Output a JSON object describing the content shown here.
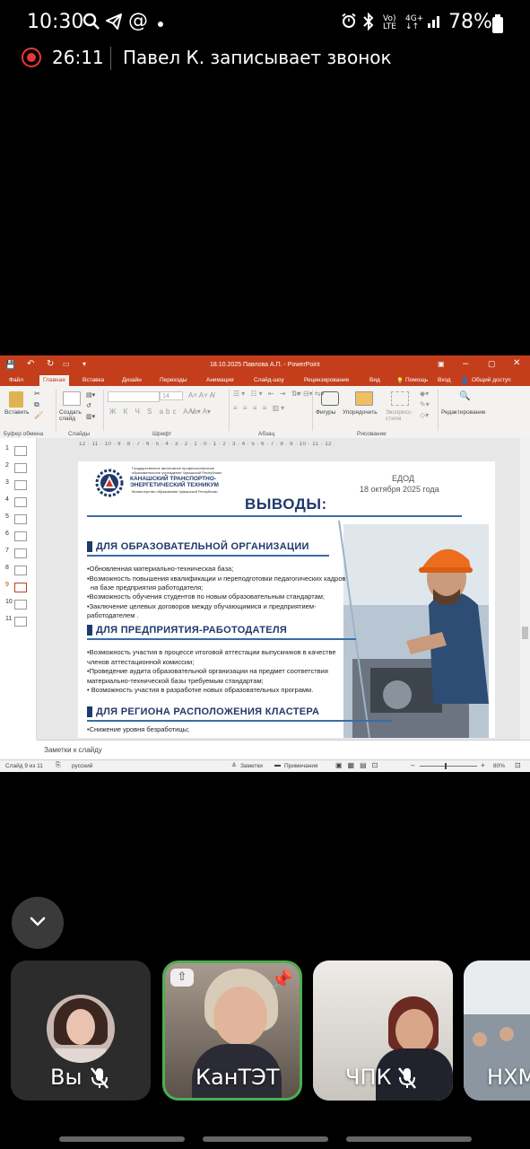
{
  "status_bar": {
    "time": "10:30",
    "battery": "78%",
    "icons": [
      "search-icon",
      "telegram-icon",
      "at-icon",
      "dot-icon",
      "alarm-icon",
      "bluetooth-icon",
      "volte-icon",
      "4g-icon",
      "signal-icon",
      "battery-icon"
    ]
  },
  "recording": {
    "timer": "26:11",
    "text": "Павел К. записывает звонок"
  },
  "ppt": {
    "title": "18.10.2025 Павлова А.П. - PowerPoint",
    "tabs": [
      "Файл",
      "Главная",
      "Вставка",
      "Дизайн",
      "Переходы",
      "Анимация",
      "Слайд-шоу",
      "Рецензирование",
      "Вид",
      "Помощь",
      "Вход",
      "Общий доступ"
    ],
    "ribbon": {
      "paste": "Вставить",
      "new_slide": "Создать слайд",
      "clipboard_group": "Буфер обмена",
      "slides_group": "Слайды",
      "font_group": "Шрифт",
      "paragraph_group": "Абзац",
      "drawing_group": "Рисование",
      "font_size": "14",
      "shapes": "Фигуры",
      "arrange": "Упорядочить",
      "styles": "Экспресс-стили",
      "editing": "Редактирование"
    },
    "ruler": "12 · 11 · 10 · 9 · 8 · 7 · 6 · 5 · 4 · 3 · 2 · 1 · 0 · 1 · 2 · 3 · 4 · 5 · 6 · 7 · 8 · 9 · 10 · 11 · 12",
    "thumbnails": [
      "1",
      "2",
      "3",
      "4",
      "5",
      "6",
      "7",
      "8",
      "9",
      "10",
      "11"
    ],
    "active_thumb": "9",
    "notes": "Заметки к слайду",
    "status": {
      "slide": "Слайд 9 из 11",
      "lang": "русский",
      "notes": "Заметки",
      "comments": "Примечания",
      "zoom": "80%"
    }
  },
  "slide": {
    "org_small": "Государственное автономное профессиональное образовательное учреждение Чувашской Республики",
    "org_name": "КАНАШСКИЙ ТРАНСПОРТНО-ЭНЕРГЕТИЧЕСКИЙ ТЕХНИКУМ",
    "ministry": "Министерство образования Чувашской Республики",
    "event": "ЕДОД",
    "date": "18 октября 2025 года",
    "title": "ВЫВОДЫ:",
    "section1": "ДЛЯ ОБРАЗОВАТЕЛЬНОЙ ОРГАНИЗАЦИИ",
    "s1_items": [
      "•Обновленная материально-техническая база;",
      "•Возможность повышения квалификации и переподготовки педагогических кадров",
      "  на базе предприятия работодателя;",
      "•Возможность обучения студентов по новым образовательным стандартам;",
      "•Заключение целевых договоров между обучающимися и предприятием-",
      "работодателем ."
    ],
    "section2": "ДЛЯ ПРЕДПРИЯТИЯ-РАБОТОДАТЕЛЯ",
    "s2_items": [
      "•Возможность участия в процессе итоговой аттестации выпускников в качестве",
      "членов аттестационной комиссии;",
      "•Проведение аудита образовательной организации на предмет соответствия",
      "материально-технической базы требуемым стандартам;",
      "• Возможность участия в разработке новых образовательных программ."
    ],
    "section3": "ДЛЯ РЕГИОНА РАСПОЛОЖЕНИЯ КЛАСТЕРА",
    "s3_items": [
      "•Снижение уровня безработицы;"
    ]
  },
  "participants": [
    {
      "name": "Вы",
      "muted": true
    },
    {
      "name": "КанТЭТ",
      "muted": false,
      "active": true
    },
    {
      "name": "ЧПК",
      "muted": true
    },
    {
      "name": "НХМ",
      "muted": false
    }
  ],
  "colors": {
    "ppt_accent": "#c43e1c",
    "active_speaker": "#4caf50",
    "recording": "#e53935",
    "slide_heading": "#1f3a6b"
  }
}
